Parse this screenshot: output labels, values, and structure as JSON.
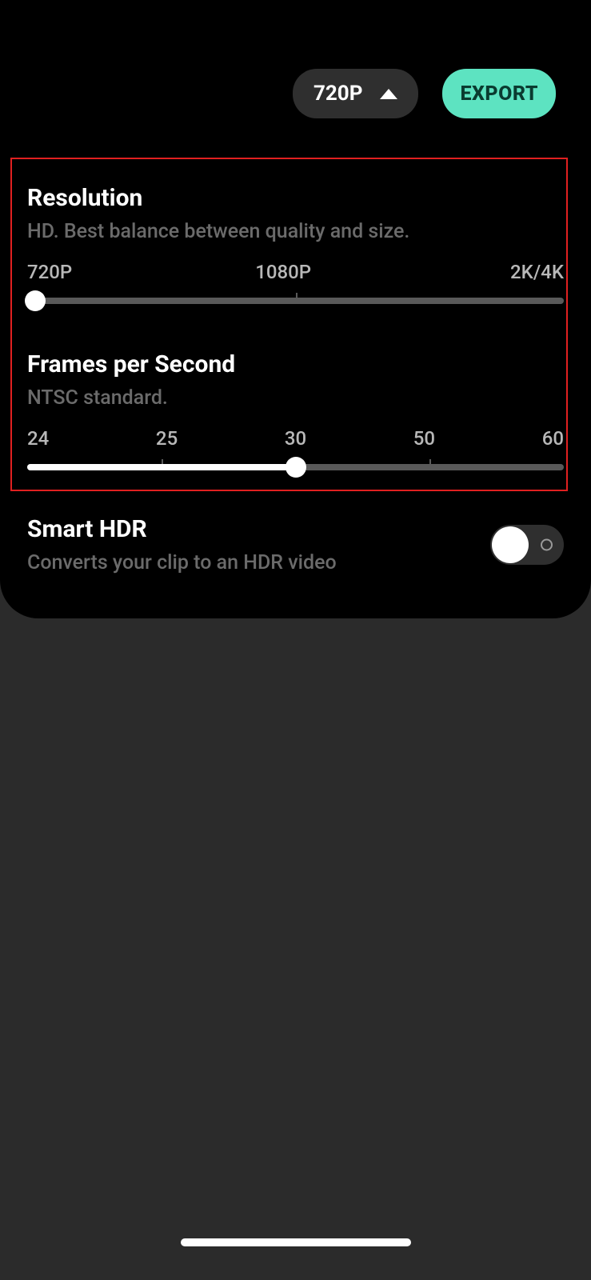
{
  "header": {
    "resolution_pill": "720P",
    "export_label": "EXPORT"
  },
  "resolution": {
    "title": "Resolution",
    "subtitle": "HD. Best balance between quality and size.",
    "ticks": [
      "720P",
      "1080P",
      "2K/4K"
    ],
    "value_index": 0
  },
  "fps": {
    "title": "Frames per Second",
    "subtitle": "NTSC standard.",
    "ticks": [
      "24",
      "25",
      "30",
      "50",
      "60"
    ],
    "value_index": 2
  },
  "hdr": {
    "title": "Smart HDR",
    "subtitle": "Converts your clip to an HDR video",
    "enabled": false
  },
  "colors": {
    "accent": "#5de3c1",
    "highlight_border": "#e02020",
    "panel_bg": "#000000",
    "page_bg": "#2b2b2b"
  }
}
